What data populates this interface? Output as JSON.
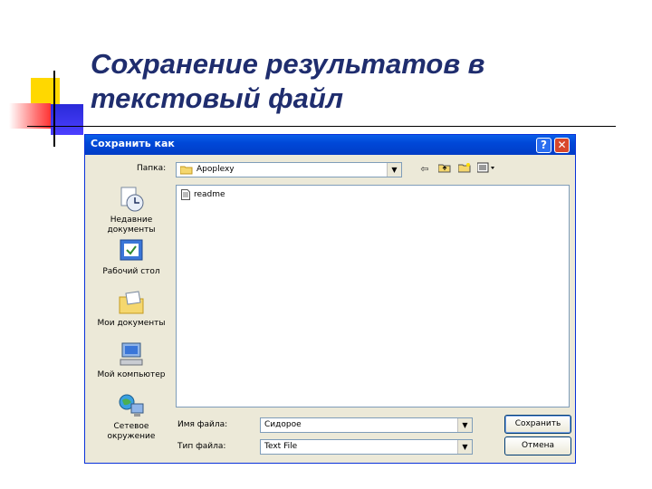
{
  "slide": {
    "title_line1": "Сохранение результатов в",
    "title_line2": "текстовый файл"
  },
  "dialog": {
    "title": "Сохранить как",
    "help_glyph": "?",
    "close_glyph": "✕",
    "folder_label": "Папка:",
    "folder_value": "Apoplexy",
    "files": [
      {
        "name": "readme",
        "icon": "text-file-icon"
      }
    ],
    "places": [
      {
        "label": "Недавние документы",
        "icon": "recent-documents-icon"
      },
      {
        "label": "Рабочий стол",
        "icon": "desktop-icon"
      },
      {
        "label": "Мои документы",
        "icon": "my-documents-icon"
      },
      {
        "label": "Мой компьютер",
        "icon": "my-computer-icon"
      },
      {
        "label": "Сетевое окружение",
        "icon": "network-places-icon"
      }
    ],
    "filename_label": "Имя файла:",
    "filename_value": "Сидорое",
    "filetype_label": "Тип файла:",
    "filetype_value": "Text File",
    "save_button": "Сохранить",
    "cancel_button": "Отмена",
    "toolbar_icons": [
      "back-icon",
      "up-folder-icon",
      "new-folder-icon",
      "view-menu-icon"
    ]
  },
  "colors": {
    "title_text": "#1f2d6e",
    "titlebar": "#0054e3",
    "dialog_bg": "#ece9d8"
  }
}
